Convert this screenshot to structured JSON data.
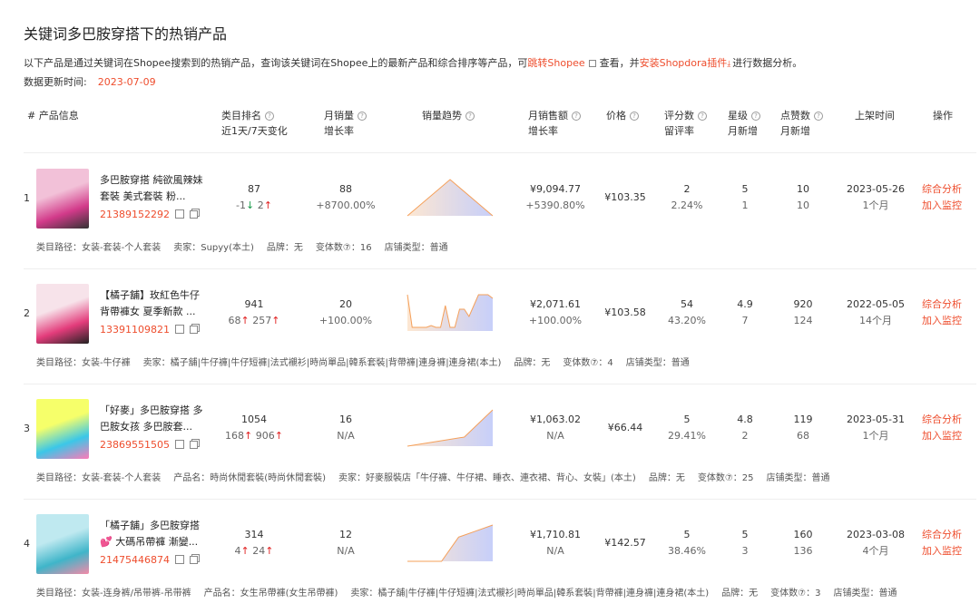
{
  "page": {
    "title": "关键词多巴胺穿搭下的热销产品",
    "desc_prefix": "以下产品是通过关键词在Shopee搜索到的热销产品，查询该关键词在Shopee上的最新产品和综合排序等产品，可",
    "link_jump": "跳转Shopee",
    "desc_mid": "查看，并",
    "link_install": "安装Shopdora插件",
    "desc_suffix": "进行数据分析。",
    "update_label": "数据更新时间:",
    "update_date": "2023-07-09"
  },
  "headers": {
    "product": "# 产品信息",
    "rank": "类目排名",
    "rank_sub": "近1天/7天变化",
    "sales": "月销量",
    "sales_sub": "增长率",
    "trend": "销量趋势",
    "revenue": "月销售额",
    "revenue_sub": "增长率",
    "price": "价格",
    "reviews": "评分数",
    "reviews_sub": "留评率",
    "stars": "星级",
    "stars_sub": "月新增",
    "likes": "点赞数",
    "likes_sub": "月新增",
    "listed": "上架时间",
    "action": "操作"
  },
  "rows": [
    {
      "num": "1",
      "name": "多巴胺穿搭 純欲風辣妹套裝 美式套裝 粉...",
      "id": "21389152292",
      "rank": "87",
      "rank_d1": "-1",
      "rank_d1_dir": "down",
      "rank_d7": "2",
      "rank_d7_dir": "up",
      "sales": "88",
      "sales_growth": "+8700.00%",
      "revenue": "¥9,094.77",
      "revenue_growth": "+5390.80%",
      "price": "¥103.35",
      "reviews": "2",
      "review_rate": "2.24%",
      "stars": "5",
      "stars_new": "1",
      "likes": "10",
      "likes_new": "10",
      "listed": "2023-05-26",
      "listed_ago": "1个月",
      "op1": "综合分析",
      "op2": "加入监控",
      "meta": [
        "类目路径：女装-套装-个人套装",
        "卖家：Supyy(本土)",
        "品牌：无",
        "变体数⑦：16",
        "店铺类型：普通"
      ],
      "trend": [
        0,
        88,
        0
      ]
    },
    {
      "num": "2",
      "name": "【橘子舖】玫紅色牛仔背帶褲女 夏季新款 ...",
      "id": "13391109821",
      "rank": "941",
      "rank_d1": "68",
      "rank_d1_dir": "up",
      "rank_d7": "257",
      "rank_d7_dir": "up",
      "sales": "20",
      "sales_growth": "+100.00%",
      "revenue": "¥2,071.61",
      "revenue_growth": "+100.00%",
      "price": "¥103.58",
      "reviews": "54",
      "review_rate": "43.20%",
      "stars": "4.9",
      "stars_new": "7",
      "likes": "920",
      "likes_new": "124",
      "listed": "2022-05-05",
      "listed_ago": "14个月",
      "op1": "综合分析",
      "op2": "加入监控",
      "meta": [
        "类目路径：女装-牛仔褲",
        "卖家：橘子舖|牛仔褲|牛仔短褲|法式襯衫|時尚單品|韓系套裝|背帶褲|連身褲|連身裙(本土)",
        "品牌：无",
        "变体数⑦：4",
        "店铺类型：普通"
      ],
      "trend": [
        20,
        2,
        2,
        2,
        2,
        3,
        2,
        2,
        14,
        2,
        2,
        12,
        12,
        8,
        14,
        20,
        20,
        20,
        18
      ]
    },
    {
      "num": "3",
      "name": "「好麥」多巴胺穿搭 多巴胺女孩 多巴胺套...",
      "id": "23869551505",
      "rank": "1054",
      "rank_d1": "168",
      "rank_d1_dir": "up",
      "rank_d7": "906",
      "rank_d7_dir": "up",
      "sales": "16",
      "sales_growth": "N/A",
      "revenue": "¥1,063.02",
      "revenue_growth": "N/A",
      "price": "¥66.44",
      "reviews": "5",
      "review_rate": "29.41%",
      "stars": "4.8",
      "stars_new": "2",
      "likes": "119",
      "likes_new": "68",
      "listed": "2023-05-31",
      "listed_ago": "1个月",
      "op1": "综合分析",
      "op2": "加入监控",
      "meta": [
        "类目路径：女装-套装-个人套装",
        "产品名：時尚休閒套裝(時尚休閒套裝)",
        "卖家：好麥服裝店「牛仔褲、牛仔裙、睡衣、連衣裙、背心、女裝」(本土)",
        "品牌：无",
        "变体数⑦：25",
        "店铺类型：普通"
      ],
      "trend": [
        0,
        2,
        4,
        16
      ]
    },
    {
      "num": "4",
      "name": "「橘子舖」多巴胺穿搭 💕 大碼吊帶褲 漸變...",
      "id": "21475446874",
      "rank": "314",
      "rank_d1": "4",
      "rank_d1_dir": "up",
      "rank_d7": "24",
      "rank_d7_dir": "up",
      "sales": "12",
      "sales_growth": "N/A",
      "revenue": "¥1,710.81",
      "revenue_growth": "N/A",
      "price": "¥142.57",
      "reviews": "5",
      "review_rate": "38.46%",
      "stars": "5",
      "stars_new": "3",
      "likes": "160",
      "likes_new": "136",
      "listed": "2023-03-08",
      "listed_ago": "4个月",
      "op1": "综合分析",
      "op2": "加入监控",
      "meta": [
        "类目路径：女装-连身裤/吊带裤-吊带裤",
        "产品名：女生吊帶褲(女生吊帶褲)",
        "卖家：橘子舖|牛仔褲|牛仔短褲|法式襯衫|時尚單品|韓系套裝|背帶褲|連身褲|連身裙(本土)",
        "品牌：无",
        "变体数⑦：3",
        "店铺类型：普通"
      ],
      "trend": [
        0,
        0,
        0,
        8,
        10,
        12
      ]
    }
  ],
  "colors": {
    "accent": "#ee4d2d",
    "up": "#e02020",
    "down": "#1a9a4a",
    "trend_area": "#c8d0fa",
    "trend_line": "#f5a05a"
  }
}
